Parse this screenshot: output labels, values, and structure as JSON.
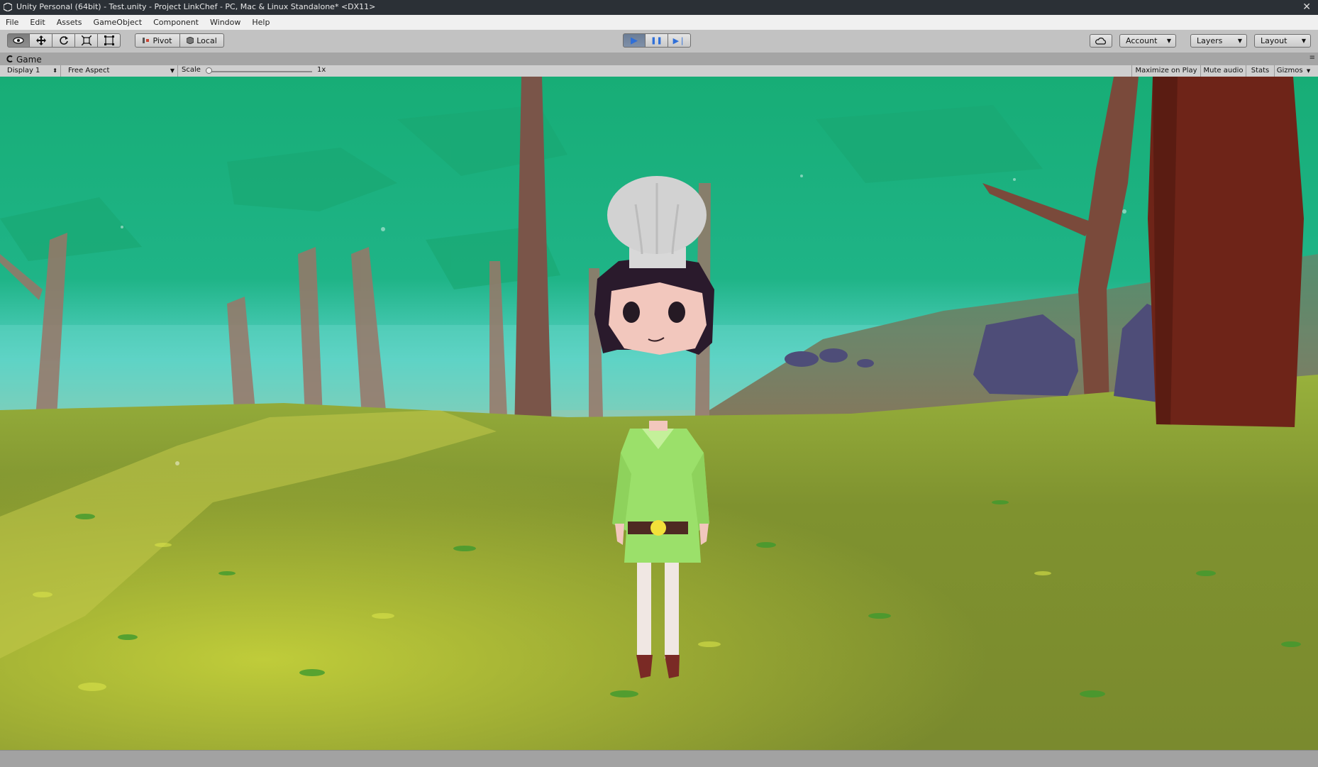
{
  "window": {
    "title": "Unity Personal (64bit) - Test.unity - Project LinkChef - PC, Mac & Linux Standalone* <DX11>",
    "close_glyph": "✕"
  },
  "menu": [
    "File",
    "Edit",
    "Assets",
    "GameObject",
    "Component",
    "Window",
    "Help"
  ],
  "toolbar": {
    "transform_tools": [
      {
        "name": "view-tool",
        "icon": "eye-icon",
        "glyph": "👁"
      },
      {
        "name": "move-tool",
        "icon": "move-arrows-icon",
        "glyph": "✥"
      },
      {
        "name": "rotate-tool",
        "icon": "rotate-icon",
        "glyph": "⟳"
      },
      {
        "name": "scale-tool",
        "icon": "scale-icon",
        "glyph": "⤢"
      },
      {
        "name": "rect-tool",
        "icon": "rect-icon",
        "glyph": "▣"
      }
    ],
    "pivot_label": "Pivot",
    "local_label": "Local",
    "play_glyph": "▶",
    "pause_glyph": "❚❚",
    "step_glyph": "▶❘",
    "account_label": "Account",
    "layers_label": "Layers",
    "layout_label": "Layout",
    "dropdown_arrow": "▼"
  },
  "game_panel": {
    "tab_label": "Game",
    "tab_menu_glyph": "≡",
    "display_label": "Display 1",
    "aspect_label": "Free Aspect",
    "scale_label": "Scale",
    "scale_value": "1x",
    "scale_level": 0.0,
    "maximize_label": "Maximize on Play",
    "mute_label": "Mute audio",
    "stats_label": "Stats",
    "gizmos_label": "Gizmos",
    "select_arrow": "⬍"
  },
  "colors": {
    "sky": "#1db27a",
    "haze": "#5fd6c6",
    "ground": "#7f8f2e",
    "ground_light": "#b9c93a",
    "trunk": "#7a5a4c",
    "big_trunk": "#6e2418",
    "tunic": "#9be06a",
    "hat": "#d8d8d8",
    "hair": "#2a1a2c",
    "skin": "#f2c7bd",
    "rock": "#4e4d78",
    "play_active": "#2f6fd8"
  }
}
